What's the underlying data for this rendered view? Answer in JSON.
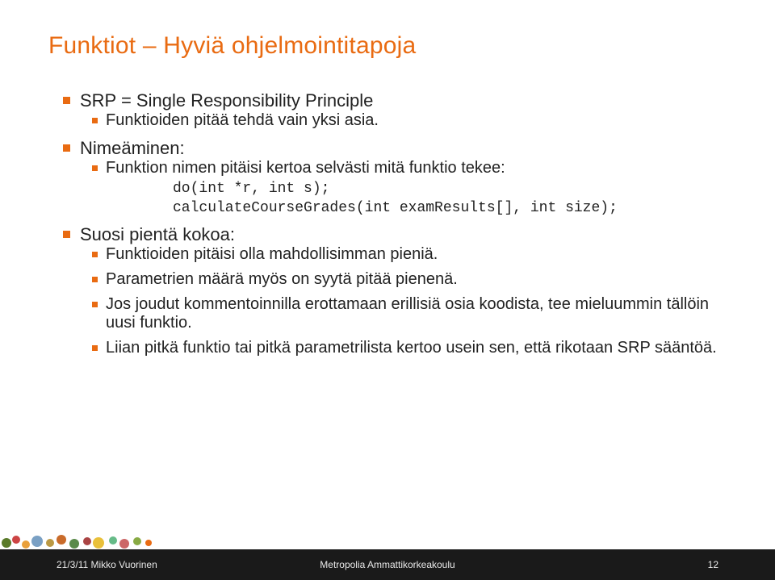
{
  "title": "Funktiot – Hyviä ohjelmointitapoja",
  "bullets": {
    "b1": "SRP = Single Responsibility Principle",
    "b1_1": "Funktioiden pitää tehdä vain yksi asia.",
    "b2": "Nimeäminen:",
    "b2_1": "Funktion nimen pitäisi kertoa selvästi mitä funktio tekee:",
    "b2_code1": "do(int *r, int s);",
    "b2_code2": "calculateCourseGrades(int examResults[], int size);",
    "b3": "Suosi pientä kokoa:",
    "b3_1": "Funktioiden pitäisi olla mahdollisimman pieniä.",
    "b3_2": "Parametrien määrä myös on syytä pitää pienenä.",
    "b3_3": "Jos joudut kommentoinnilla erottamaan erillisiä osia koodista, tee mieluummin tällöin uusi funktio.",
    "b3_4": "Liian pitkä funktio tai pitkä parametrilista kertoo usein sen, että rikotaan SRP sääntöä."
  },
  "footer": {
    "left": "21/3/11 Mikko Vuorinen",
    "center": "Metropolia Ammattikorkeakoulu",
    "right": "12"
  }
}
